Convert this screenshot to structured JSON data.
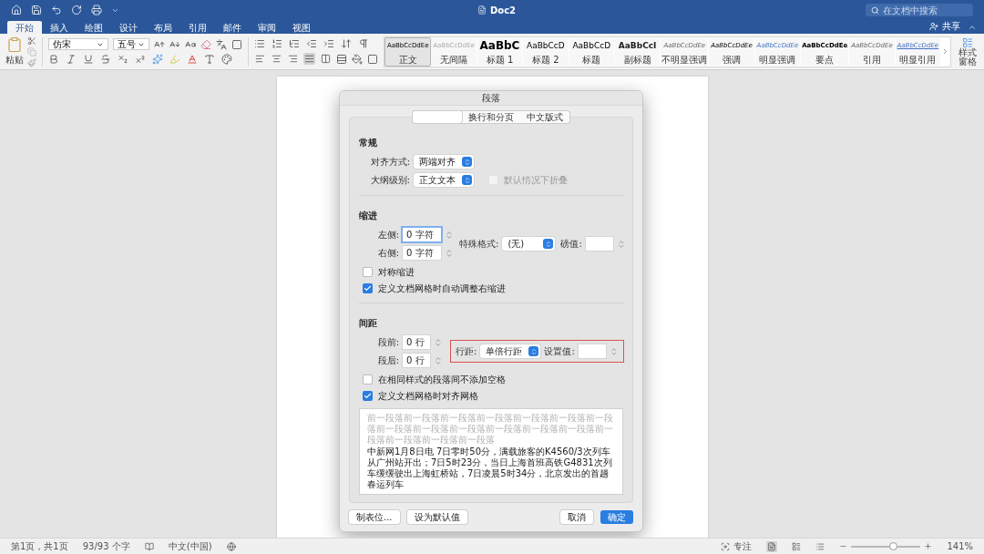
{
  "title_bar": {
    "title": "Doc2",
    "search": {
      "placeholder": "在文档中搜索"
    },
    "share": "共享"
  },
  "ribbon_tabs": [
    {
      "label": "开始",
      "selected": true
    },
    {
      "label": "插入",
      "selected": false
    },
    {
      "label": "绘图",
      "selected": false
    },
    {
      "label": "设计",
      "selected": false
    },
    {
      "label": "布局",
      "selected": false
    },
    {
      "label": "引用",
      "selected": false
    },
    {
      "label": "邮件",
      "selected": false
    },
    {
      "label": "审阅",
      "selected": false
    },
    {
      "label": "视图",
      "selected": false
    }
  ],
  "ribbon": {
    "paste_label": "粘贴",
    "font": {
      "name": "仿宋",
      "size": "五号"
    },
    "alignment_buttons": [
      {
        "kind": "left",
        "selected": false
      },
      {
        "kind": "center",
        "selected": false
      },
      {
        "kind": "right",
        "selected": false
      },
      {
        "kind": "justify",
        "selected": true
      },
      {
        "kind": "distributed",
        "selected": false
      }
    ],
    "styles": [
      {
        "kind": "normal",
        "preview": "AaBbCcDdEe",
        "name": "正文",
        "selected": true
      },
      {
        "kind": "faded",
        "preview": "AaBbCcDdEe",
        "name": "无间隔",
        "selected": false
      },
      {
        "kind": "heading1",
        "preview": "AaBbC",
        "name": "标题 1",
        "selected": false
      },
      {
        "kind": "heading2",
        "preview": "AaBbCcD",
        "name": "标题 2",
        "selected": false
      },
      {
        "kind": "heading2",
        "preview": "AaBbCcD",
        "name": "标题",
        "selected": false
      },
      {
        "kind": "subtitle",
        "preview": "AaBbCcI",
        "name": "副标题",
        "selected": false
      },
      {
        "kind": "subtle",
        "preview": "AaBbCcDdEe",
        "name": "不明显强调",
        "selected": false
      },
      {
        "kind": "emphasis",
        "preview": "AaBbCcDdEe",
        "name": "强调",
        "selected": false
      },
      {
        "kind": "intense",
        "preview": "AaBbCcDdEe",
        "name": "明显强调",
        "selected": false
      },
      {
        "kind": "strong",
        "preview": "AaBbCcDdEe",
        "name": "要点",
        "selected": false
      },
      {
        "kind": "subtle",
        "preview": "AaBbCcDdEe",
        "name": "引用",
        "selected": false
      },
      {
        "kind": "intense_quote",
        "preview": "AaBbCcDdEe",
        "name": "明显引用",
        "selected": false
      }
    ],
    "styles_pane": "样式窗格"
  },
  "dialog": {
    "title": "段落",
    "tabs": [
      {
        "selected": true
      },
      {
        "label": "换行和分页",
        "selected": false
      },
      {
        "label": "中文版式",
        "selected": false
      }
    ],
    "general": {
      "heading": "常规",
      "alignment": {
        "label": "对齐方式:",
        "value": "两端对齐"
      },
      "outline": {
        "label": "大纲级别:",
        "value": "正文文本"
      },
      "collapse": {
        "label": "默认情况下折叠",
        "checked": false,
        "disabled": true
      }
    },
    "indent": {
      "heading": "缩进",
      "left": {
        "label": "左侧:",
        "value": "0 字符",
        "focused": true
      },
      "right": {
        "label": "右侧:",
        "value": "0 字符",
        "focused": false
      },
      "special": {
        "label": "特殊格式:",
        "value": "(无)"
      },
      "amount": {
        "label": "磅值:"
      },
      "checkboxes": [
        {
          "label": "对称缩进",
          "checked": false
        },
        {
          "label": "定义文档网格时自动调整右缩进",
          "checked": true
        }
      ]
    },
    "spacing": {
      "heading": "间距",
      "before": {
        "label": "段前:",
        "value": "0 行"
      },
      "after": {
        "label": "段后:",
        "value": "0 行"
      },
      "line_spacing": {
        "label": "行距:",
        "value": "单倍行距",
        "highlighted": true
      },
      "setting": {
        "label": "设置值:"
      },
      "checkboxes": [
        {
          "label": "在相同样式的段落间不添加空格",
          "checked": false
        },
        {
          "label": "定义文档网格时对齐网格",
          "checked": true
        }
      ]
    },
    "preview": {
      "previous_text": "前一段落前一段落前一段落前一段落前一段落前一段落前一段落前一段落前一段落前一段落前一段落前一段落前一段落前一段落前一段落前一段落前一段落",
      "sample_text": "中新网1月8日电 7日零时50分，满载旅客的K4560/3次列车从广州站开出；7日5时23分，当日上海首班高铁G4831次列车缓缓驶出上海虹桥站，7日凌晨5时34分，北京发出的首趟春运列车"
    },
    "buttons": [
      {
        "label": "制表位...",
        "kind": "secondary"
      },
      {
        "label": "设为默认值",
        "kind": "secondary"
      },
      {
        "label": "取消",
        "kind": "secondary"
      },
      {
        "label": "确定",
        "kind": "primary"
      }
    ]
  },
  "status_bar": {
    "page": "第1页，共1页",
    "words": "93/93 个字",
    "language": "中文(中国)",
    "focus": "专注",
    "zoom": {
      "level": 0.6,
      "reading": "141%"
    }
  }
}
